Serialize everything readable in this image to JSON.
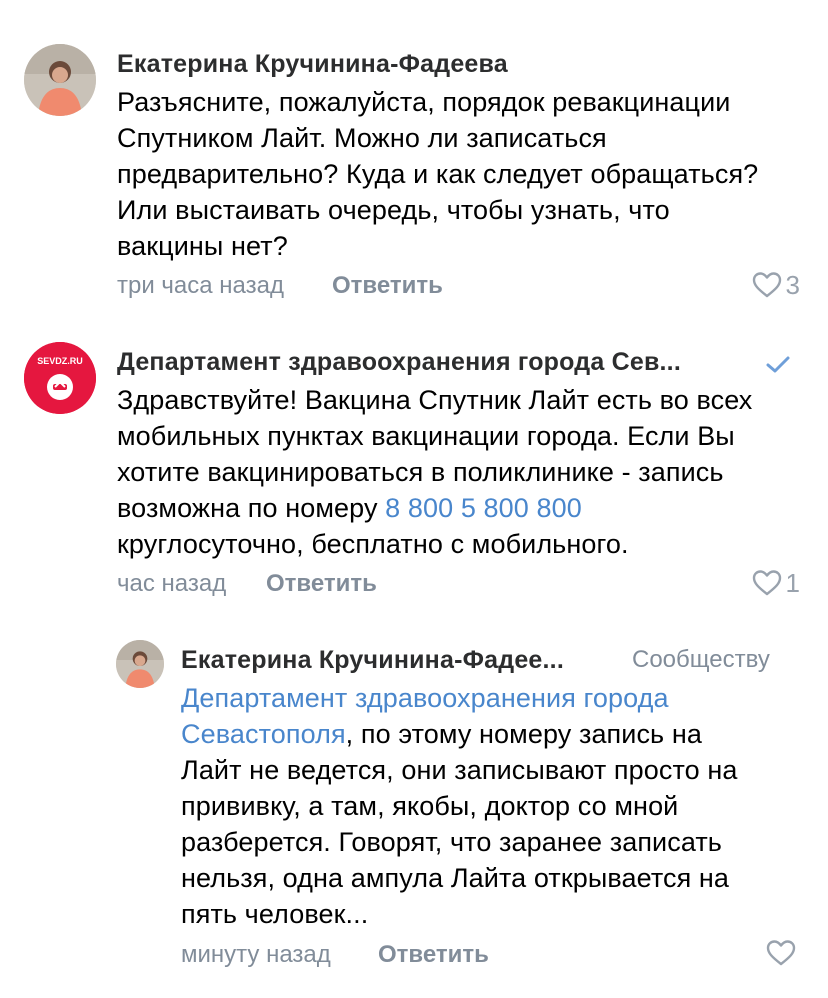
{
  "colors": {
    "link": "#4986cc",
    "meta": "#818c99",
    "author": "#2c2d2e",
    "dept_brand": "#e5173f"
  },
  "comments": [
    {
      "author": "Екатерина Кручинина-Фадеева",
      "avatar_icon": "user-photo-avatar",
      "lines": [
        "Разъясните, пожалуйста, порядок ревакцинации",
        "Спутником Лайт. Можно ли записаться",
        "предварительно? Куда и как следует обращаться?",
        "Или выстаивать очередь, чтобы узнать, что",
        "вакцины нет?"
      ],
      "time": "три часа назад",
      "reply_label": "Ответить",
      "likes": "3"
    },
    {
      "author": "Департамент здравоохранения города Сев...",
      "avatar_text": "SEVDZ.RU",
      "avatar_icon": "department-logo-avatar",
      "verified_icon": "verified-check-icon",
      "line1": "Здравствуйте! Вакцина Спутник Лайт есть во всех",
      "line2": "мобильных пунктах вакцинации города. Если Вы",
      "line3": "хотите вакцинироваться в поликлинике - запись",
      "line4_pre": "возможна по номеру ",
      "phone": "8 800 5 800 800",
      "line5": "круглосуточно, бесплатно с мобильного.",
      "time": "час назад",
      "reply_label": "Ответить",
      "likes": "1"
    },
    {
      "author": "Екатерина Кручинина-Фадее...",
      "to_whom": "Сообществу",
      "avatar_icon": "user-photo-avatar",
      "mention_line1": "Департамент здравоохранения города",
      "mention_line2": "Севастополя",
      "line2_post": ", по этому номеру запись на",
      "lines": [
        "Лайт не ведется, они записывают просто на",
        "прививку, а там, якобы, доктор со мной",
        "разберется. Говорят, что заранее записать",
        "нельзя, одна ампула Лайта открывается на",
        "пять человек..."
      ],
      "time": "минуту назад",
      "reply_label": "Ответить",
      "likes": ""
    }
  ]
}
